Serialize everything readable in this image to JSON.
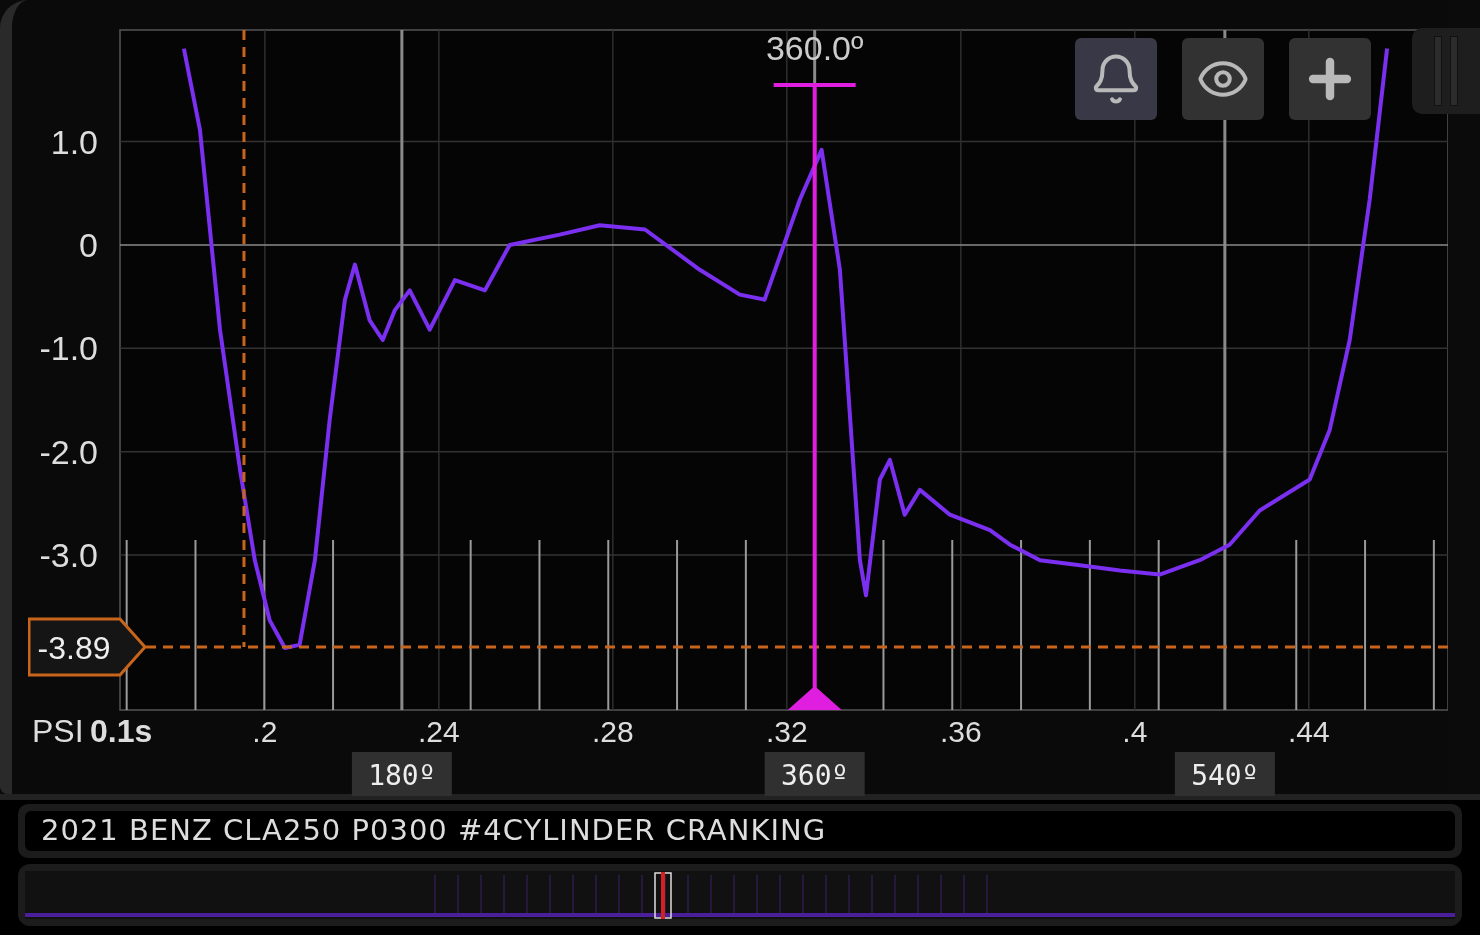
{
  "chart": {
    "chart_data": {
      "type": "line",
      "xlabel": "0.1s",
      "ylabel": "PSI",
      "grid": true,
      "x": [
        0.1814,
        0.1851,
        0.1897,
        0.1943,
        0.1977,
        0.2011,
        0.2046,
        0.208,
        0.2115,
        0.2149,
        0.2184,
        0.2207,
        0.2241,
        0.2271,
        0.2299,
        0.2333,
        0.2379,
        0.2437,
        0.2506,
        0.2563,
        0.2678,
        0.277,
        0.2874,
        0.3,
        0.3092,
        0.3149,
        0.323,
        0.328,
        0.3322,
        0.3368,
        0.3382,
        0.3414,
        0.3437,
        0.3471,
        0.3506,
        0.3575,
        0.3667,
        0.3713,
        0.3782,
        0.3874,
        0.3966,
        0.4057,
        0.4149,
        0.4218,
        0.4287,
        0.4402,
        0.4448,
        0.4494,
        0.454,
        0.458
      ],
      "series": [
        {
          "color": "#7b2ff0",
          "values": [
            1.9,
            1.11,
            -0.82,
            -2.18,
            -3.05,
            -3.63,
            -3.9,
            -3.87,
            -3.05,
            -1.69,
            -0.53,
            -0.19,
            -0.73,
            -0.92,
            -0.63,
            -0.44,
            -0.82,
            -0.34,
            -0.44,
            0.0,
            0.1,
            0.19,
            0.15,
            -0.24,
            -0.48,
            -0.53,
            0.44,
            0.92,
            -0.24,
            -3.05,
            -3.39,
            -2.27,
            -2.08,
            -2.61,
            -2.37,
            -2.61,
            -2.76,
            -2.9,
            -3.05,
            -3.1,
            -3.15,
            -3.19,
            -3.05,
            -2.9,
            -2.57,
            -2.27,
            -1.79,
            -0.92,
            0.44,
            1.9
          ]
        }
      ],
      "xlim": [
        0.1667,
        0.472
      ],
      "ylim": [
        -4.5,
        2.08
      ],
      "xticks": [
        {
          "value": 0.2,
          "label": ".2"
        },
        {
          "value": 0.24,
          "label": ".24"
        },
        {
          "value": 0.28,
          "label": ".28"
        },
        {
          "value": 0.32,
          "label": ".32"
        },
        {
          "value": 0.36,
          "label": ".36"
        },
        {
          "value": 0.4,
          "label": ".4"
        },
        {
          "value": 0.44,
          "label": ".44"
        }
      ],
      "yticks": [
        {
          "value": 1,
          "label": "1.0"
        },
        {
          "value": 0,
          "label": "0"
        },
        {
          "value": -1,
          "label": "-1.0"
        },
        {
          "value": -2,
          "label": "-2.0"
        },
        {
          "value": -3,
          "label": "-3.0"
        }
      ],
      "ref_lines": [
        {
          "axis": "y",
          "value": -3.89,
          "label": "-3.89",
          "color": "#c8651a"
        },
        {
          "axis": "x",
          "value": 0.1952,
          "color": "#c8651a"
        },
        {
          "axis": "x",
          "value": 0.3264,
          "color": "#e01ee0"
        },
        {
          "axis": "x",
          "value": 0.2315,
          "color": "#8a8a8a"
        },
        {
          "axis": "x",
          "value": 0.3264,
          "color": "#8a8a8a"
        },
        {
          "axis": "x",
          "value": 0.4207,
          "color": "#8a8a8a"
        }
      ]
    },
    "crank_angle": {
      "cursor_label": "360.0º",
      "marks": [
        "180º",
        "360º",
        "540º"
      ]
    }
  },
  "toolbar": [
    {
      "kind": "bell",
      "active": true
    },
    {
      "kind": "eye",
      "active": false
    },
    {
      "kind": "plus",
      "active": false
    }
  ],
  "title": "2021 BENZ CLA250 P0300 #4CYLINDER CRANKING"
}
